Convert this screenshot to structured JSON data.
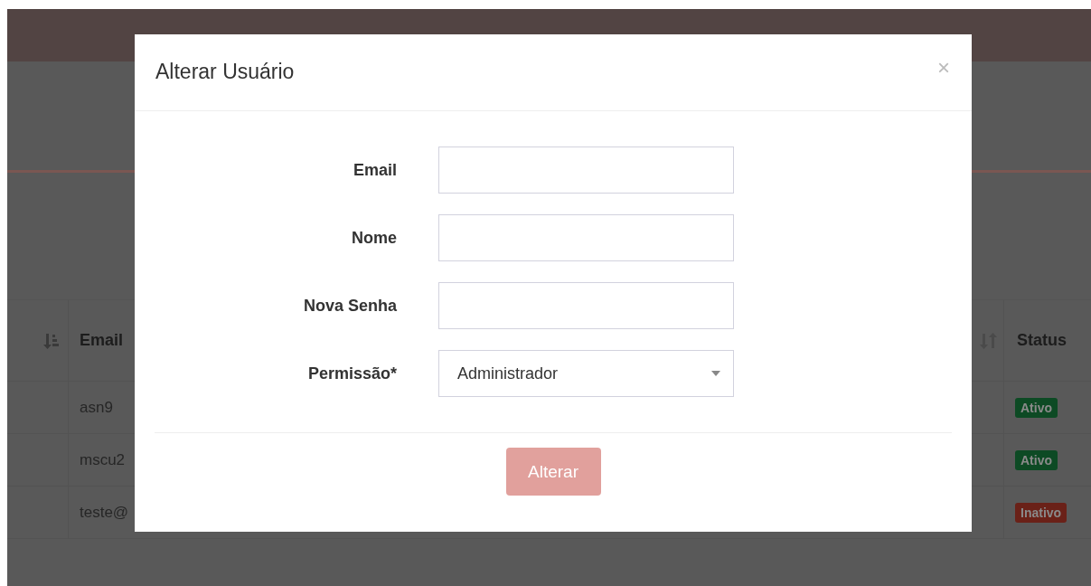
{
  "table": {
    "email_header": "Email",
    "status_header": "Status",
    "rows": [
      {
        "email": "asn9",
        "status": "Ativo",
        "active": true
      },
      {
        "email": "mscu2",
        "status": "Ativo",
        "active": true
      },
      {
        "email": "teste@",
        "status": "Inativo",
        "active": false
      }
    ]
  },
  "modal": {
    "title": "Alterar Usuário",
    "close": "×",
    "fields": [
      {
        "label": "Email",
        "kind": "text"
      },
      {
        "label": "Nome",
        "kind": "text"
      },
      {
        "label": "Nova Senha",
        "kind": "password"
      },
      {
        "label": "Permissão*",
        "kind": "select",
        "value": "Administrador"
      }
    ],
    "button": {
      "label": "Alterar",
      "disabled": true
    }
  }
}
